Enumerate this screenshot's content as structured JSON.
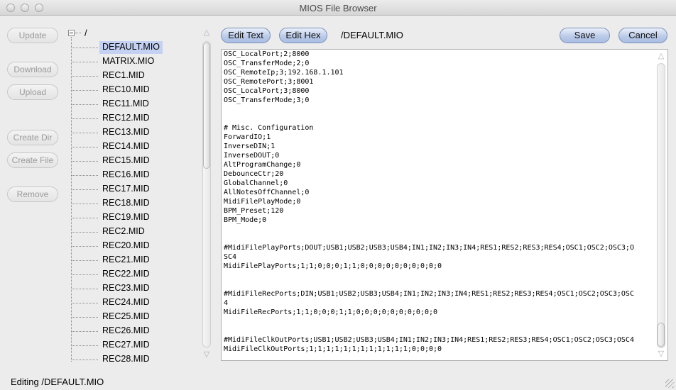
{
  "window": {
    "title": "MIOS File Browser"
  },
  "left_buttons": {
    "update": "Update",
    "download": "Download",
    "upload": "Upload",
    "create_dir": "Create Dir",
    "create_file": "Create File",
    "remove": "Remove"
  },
  "tree": {
    "root": "/",
    "items": [
      "DEFAULT.MIO",
      "MATRIX.MIO",
      "REC1.MID",
      "REC10.MID",
      "REC11.MID",
      "REC12.MID",
      "REC13.MID",
      "REC14.MID",
      "REC15.MID",
      "REC16.MID",
      "REC17.MID",
      "REC18.MID",
      "REC19.MID",
      "REC2.MID",
      "REC20.MID",
      "REC21.MID",
      "REC22.MID",
      "REC23.MID",
      "REC24.MID",
      "REC25.MID",
      "REC26.MID",
      "REC27.MID",
      "REC28.MID"
    ],
    "selected": "DEFAULT.MIO"
  },
  "toolbar": {
    "edit_text": "Edit Text",
    "edit_hex": "Edit Hex",
    "path": "/DEFAULT.MIO",
    "save": "Save",
    "cancel": "Cancel"
  },
  "editor": {
    "lines": [
      "OSC_LocalPort;2;8000",
      "OSC_TransferMode;2;0",
      "OSC_RemoteIp;3;192.168.1.101",
      "OSC_RemotePort;3;8001",
      "OSC_LocalPort;3;8000",
      "OSC_TransferMode;3;0",
      "",
      "",
      "# Misc. Configuration",
      "ForwardIO;1",
      "InverseDIN;1",
      "InverseDOUT;0",
      "AltProgramChange;0",
      "DebounceCtr;20",
      "GlobalChannel;0",
      "AllNotesOffChannel;0",
      "MidiFilePlayMode;0",
      "BPM_Preset;120",
      "BPM_Mode;0",
      "",
      "",
      "#MidiFilePlayPorts;DOUT;USB1;USB2;USB3;USB4;IN1;IN2;IN3;IN4;RES1;RES2;RES3;RES4;OSC1;OSC2;OSC3;O",
      "SC4",
      "MidiFilePlayPorts;1;1;0;0;0;1;1;0;0;0;0;0;0;0;0;0;0",
      "",
      "",
      "#MidiFileRecPorts;DIN;USB1;USB2;USB3;USB4;IN1;IN2;IN3;IN4;RES1;RES2;RES3;RES4;OSC1;OSC2;OSC3;OSC",
      "4",
      "MidiFileRecPorts;1;1;0;0;0;1;1;0;0;0;0;0;0;0;0;0;0",
      "",
      "",
      "#MidiFileClkOutPorts;USB1;USB2;USB3;USB4;IN1;IN2;IN3;IN4;RES1;RES2;RES3;RES4;OSC1;OSC2;OSC3;OSC4",
      "MidiFileClkOutPorts;1;1;1;1;1;1;1;1;1;1;1;1;0;0;0;0"
    ]
  },
  "status": {
    "text": "Editing /DEFAULT.MIO"
  },
  "icons": {
    "tree_toggle": "minus-box-icon",
    "scroll_up": "triangle-up-icon",
    "scroll_down": "triangle-down-icon",
    "resize_grip": "resize-grip-icon"
  }
}
